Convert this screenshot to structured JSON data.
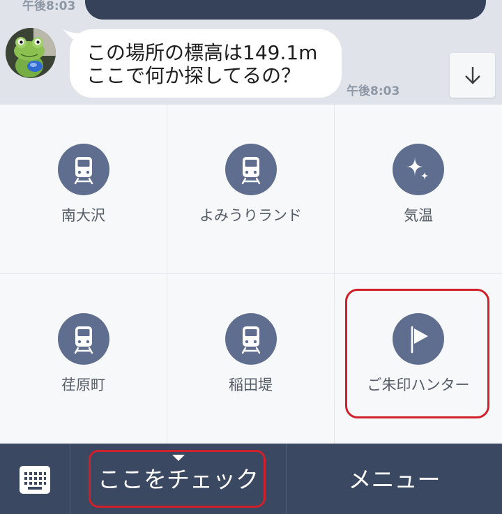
{
  "chat": {
    "previous_time": "午後8:03",
    "message_lines": [
      "この場所の標高は149.1m",
      "ここで何か探してるの？"
    ],
    "message_time": "午後8:03",
    "avatar_icon": "frog-avatar-icon",
    "scroll_down_icon": "arrow-down-icon"
  },
  "menu_grid": [
    {
      "label": "南大沢",
      "icon": "train-icon"
    },
    {
      "label": "よみうりランド",
      "icon": "train-icon"
    },
    {
      "label": "気温",
      "icon": "sparkle-icon"
    },
    {
      "label": "荏原町",
      "icon": "train-icon"
    },
    {
      "label": "稲田堤",
      "icon": "train-icon"
    },
    {
      "label": "ご朱印ハンター",
      "icon": "flag-icon"
    }
  ],
  "bottom_bar": {
    "keyboard_icon": "keyboard-icon",
    "check_label": "ここをチェック",
    "menu_label": "メニュー"
  },
  "colors": {
    "chat_background": "#e0e4ea",
    "icon_circle": "#5f6e8e",
    "bottom_bar": "#3a4862",
    "highlight_box": "#d0202c"
  }
}
